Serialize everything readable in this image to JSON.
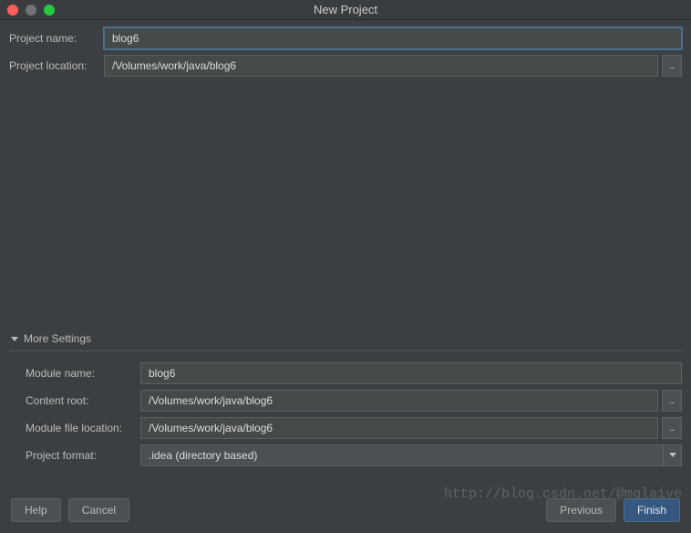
{
  "window": {
    "title": "New Project"
  },
  "form": {
    "project_name_label": "Project name:",
    "project_name_value": "blog6",
    "project_location_label": "Project location:",
    "project_location_value": "/Volumes/work/java/blog6"
  },
  "more_settings": {
    "header": "More Settings",
    "module_name_label": "Module name:",
    "module_name_value": "blog6",
    "content_root_label": "Content root:",
    "content_root_value": "/Volumes/work/java/blog6",
    "module_file_location_label": "Module file location:",
    "module_file_location_value": "/Volumes/work/java/blog6",
    "project_format_label": "Project format:",
    "project_format_value": ".idea (directory based)"
  },
  "buttons": {
    "help": "Help",
    "cancel": "Cancel",
    "previous": "Previous",
    "finish": "Finish"
  },
  "browse_glyph": "...",
  "watermark": "http://blog.csdn.net/@mglaive"
}
